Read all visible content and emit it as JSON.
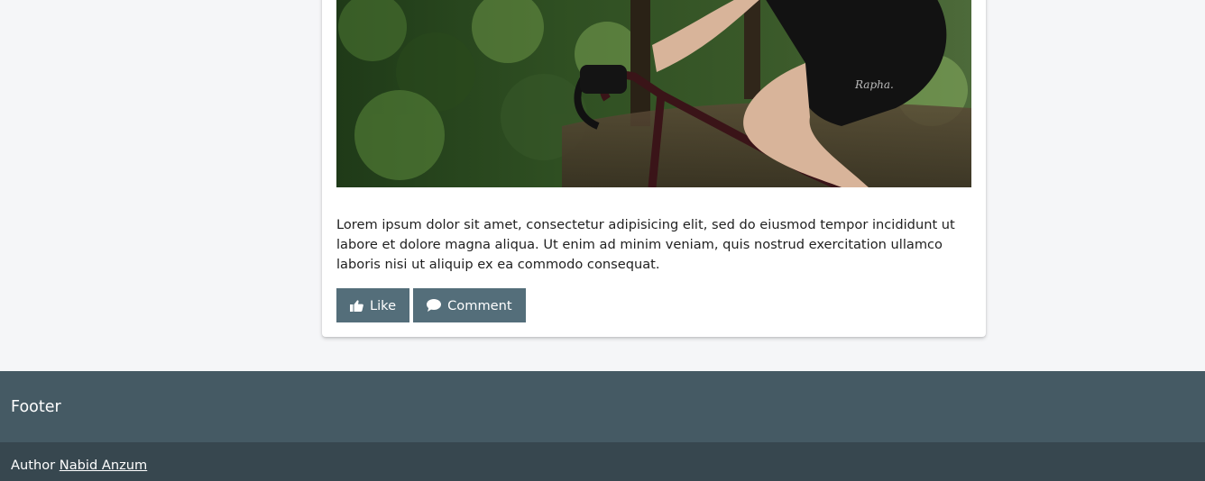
{
  "post": {
    "image_alt": "Cyclist riding a road bike through a forest",
    "jersey_logo_text": "Rapha.",
    "text": "Lorem ipsum dolor sit amet, consectetur adipisicing elit, sed do eiusmod tempor incididunt ut labore et dolore magna aliqua. Ut enim ad minim veniam, quis nostrud exercitation ullamco laboris nisi ut aliquip ex ea commodo consequat.",
    "like_label": "Like",
    "like_icon": "thumbs-up-icon",
    "comment_label": "Comment",
    "comment_icon": "speech-bubble-icon"
  },
  "footer": {
    "title": "Footer",
    "author_prefix": "Author",
    "author_name": "Nabid Anzum"
  },
  "colors": {
    "page_bg": "#f5f6f8",
    "button_bg": "#546e7a",
    "footer_top": "#455a64",
    "footer_bottom": "#37474f"
  }
}
